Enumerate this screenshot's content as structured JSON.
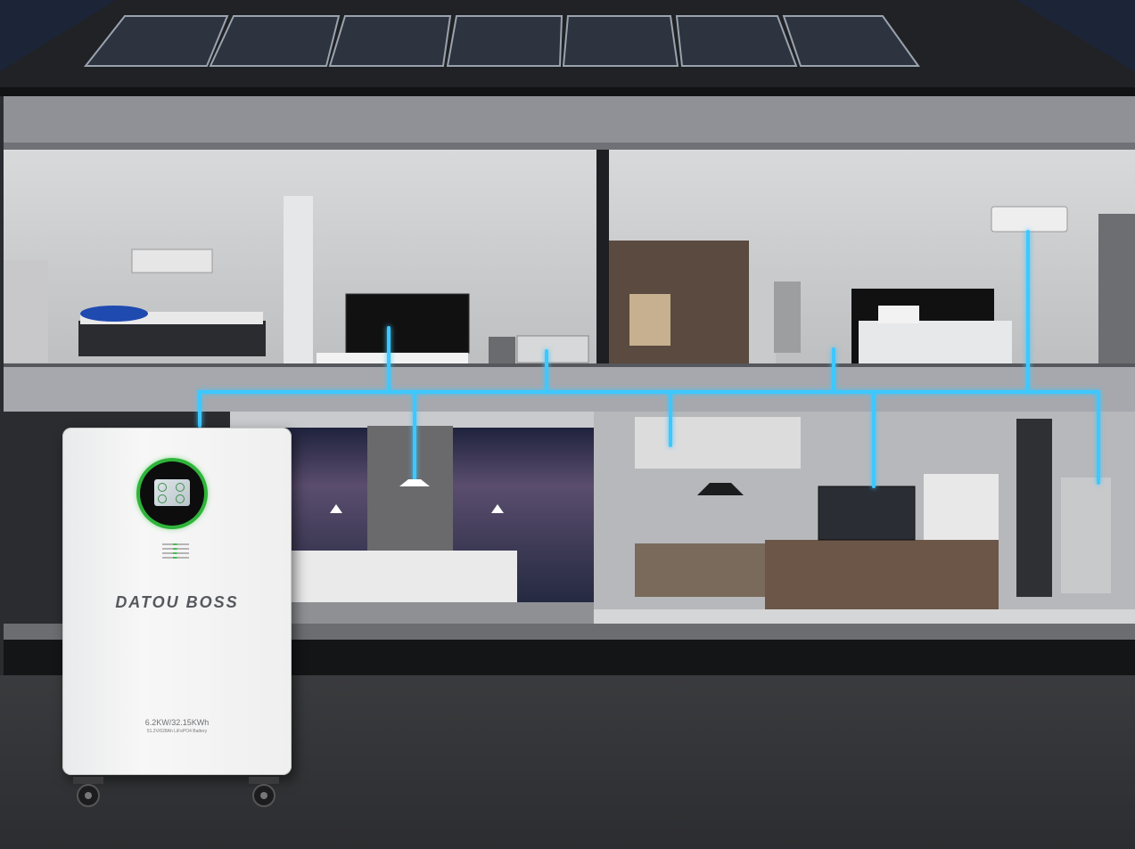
{
  "battery": {
    "brand": "DATOU BOSS",
    "capacity": "6.2KW/32.15KWh",
    "cell_spec": "51.2V/628Ah LiFePO4 Battery"
  },
  "colors": {
    "energy_line": "#3ec8ff",
    "display_ring": "#2fb43a",
    "night_sky": "#1a2436"
  },
  "icons": [
    "solar-panel-icon",
    "battery-icon",
    "tv-icon",
    "air-conditioner-icon",
    "pendant-lamp-icon"
  ]
}
